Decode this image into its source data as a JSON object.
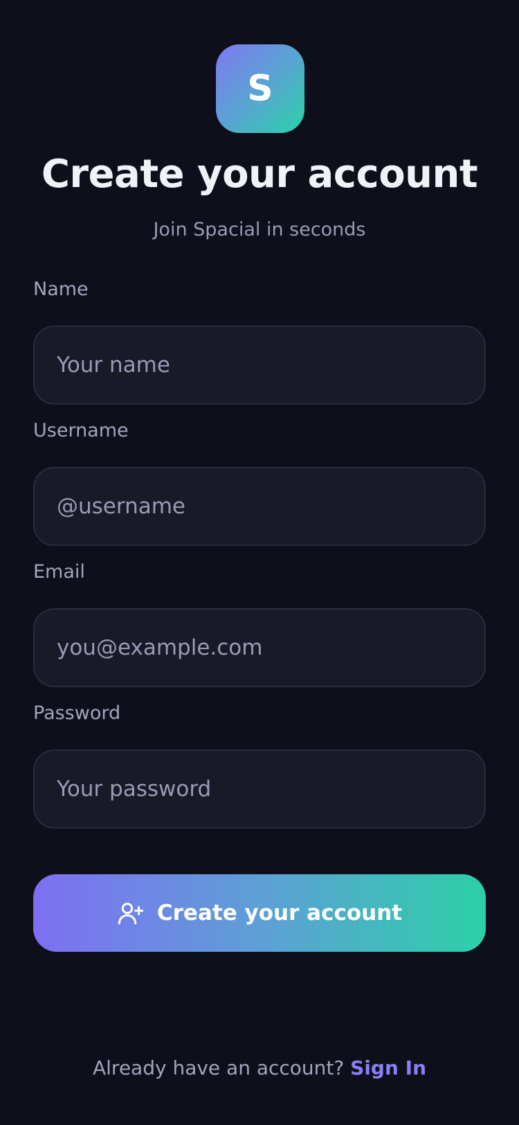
{
  "brand": {
    "logo_letter": "S",
    "gradient_start": "#7f78f2",
    "gradient_end": "#2bd1a8"
  },
  "header": {
    "title": "Create your account",
    "subtitle": "Join Spacial in seconds"
  },
  "form": {
    "name": {
      "label": "Name",
      "placeholder": "Your name",
      "value": ""
    },
    "username": {
      "label": "Username",
      "placeholder": "@username",
      "value": ""
    },
    "email": {
      "label": "Email",
      "placeholder": "you@example.com",
      "value": ""
    },
    "password": {
      "label": "Password",
      "placeholder": "Your password",
      "value": ""
    },
    "submit": {
      "label": "Create your account",
      "icon": "user-plus-icon"
    }
  },
  "footer": {
    "prompt": "Already have an account?",
    "link_label": "Sign In",
    "link_color": "#8a80f5"
  },
  "colors": {
    "background": "#0e0f1a",
    "input_background": "#181a28",
    "input_border": "#2a2c3e",
    "text_primary": "#f1f1f8",
    "text_secondary": "#9a9bb5"
  }
}
